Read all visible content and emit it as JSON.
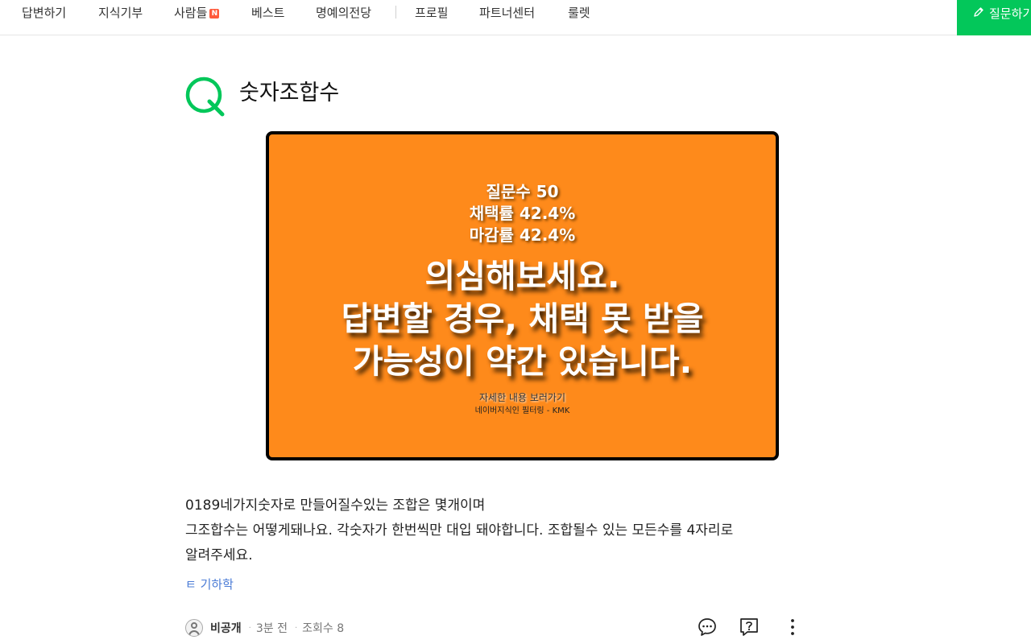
{
  "nav": {
    "items": [
      "답변하기",
      "지식기부",
      "사람들",
      "베스트",
      "명예의전당",
      "프로필",
      "파트너센터",
      "룰렛"
    ],
    "new_badge": "N",
    "ask_button": "질문하기"
  },
  "question": {
    "title": "숫자조합수",
    "accent_color": "#03c75a"
  },
  "banner": {
    "background": "#fe8a1b",
    "stats": [
      "질문수 50",
      "채택률 42.4%",
      "마감률 42.4%"
    ],
    "warning": [
      "의심해보세요.",
      "답변할 경우, 채택 못 받을",
      "가능성이 약간 있습니다."
    ],
    "detail_link": "자세한 내용 보러가기",
    "credit": "네이버지식인 필터링 - KMK"
  },
  "body": {
    "lines": [
      "0189네가지숫자로 만들어질수있는 조합은 몇개이며",
      "그조합수는 어떻게돼나요. 각숫자가 한번씩만 대입 돼야합니다. 조합될수 있는 모든수를 4자리로",
      "알려주세요."
    ]
  },
  "tag": "ㅌ 기하학",
  "meta": {
    "author": "비공개",
    "time": "3분 전",
    "views": "조회수 8",
    "separator": "·"
  },
  "icons": {
    "comment": "comment-icon",
    "question": "question-icon",
    "more": "more-vertical-icon",
    "edit": "pencil-icon"
  }
}
